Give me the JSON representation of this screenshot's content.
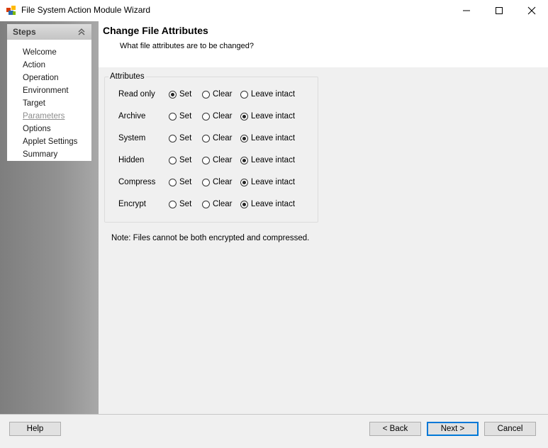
{
  "window": {
    "title": "File System Action Module Wizard"
  },
  "steps": {
    "title": "Steps",
    "items": [
      {
        "label": "Welcome"
      },
      {
        "label": "Action"
      },
      {
        "label": "Operation"
      },
      {
        "label": "Environment"
      },
      {
        "label": "Target"
      },
      {
        "label": "Parameters",
        "current": true
      },
      {
        "label": "Options"
      },
      {
        "label": "Applet Settings"
      },
      {
        "label": "Summary"
      }
    ]
  },
  "header": {
    "title": "Change File Attributes",
    "subtitle": "What file attributes are to be changed?"
  },
  "attributes": {
    "legend": "Attributes",
    "option_labels": {
      "set": "Set",
      "clear": "Clear",
      "leave": "Leave intact"
    },
    "rows": [
      {
        "label": "Read only",
        "selected": "set"
      },
      {
        "label": "Archive",
        "selected": "leave"
      },
      {
        "label": "System",
        "selected": "leave"
      },
      {
        "label": "Hidden",
        "selected": "leave"
      },
      {
        "label": "Compress",
        "selected": "leave"
      },
      {
        "label": "Encrypt",
        "selected": "leave"
      }
    ]
  },
  "note": "Note: Files cannot be both encrypted and compressed.",
  "footer": {
    "help_label": "Help",
    "back_label": "< Back",
    "next_label": "Next >",
    "cancel_label": "Cancel"
  }
}
